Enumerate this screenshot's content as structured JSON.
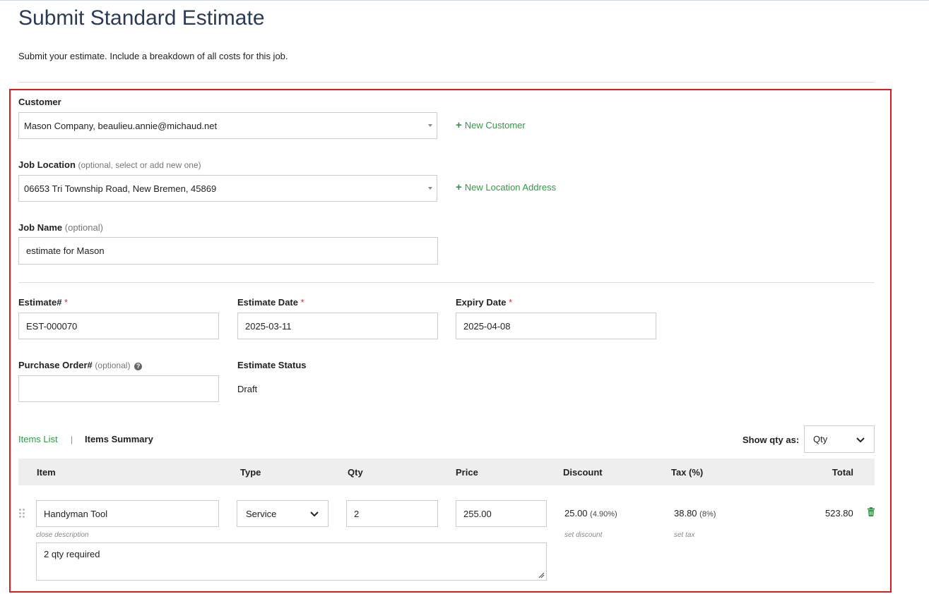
{
  "page": {
    "title": "Submit Standard Estimate",
    "subtitle": "Submit your estimate. Include a breakdown of all costs for this job."
  },
  "customer": {
    "label": "Customer",
    "value": "Mason Company, beaulieu.annie@michaud.net",
    "new_link": "New Customer"
  },
  "job_location": {
    "label": "Job Location",
    "hint": "(optional, select or add new one)",
    "value": "06653 Tri Township Road, New Bremen, 45869",
    "new_link": "New Location Address"
  },
  "job_name": {
    "label": "Job Name",
    "hint": "(optional)",
    "value": "estimate for Mason"
  },
  "estimate_no": {
    "label": "Estimate#",
    "required": "*",
    "value": "EST-000070"
  },
  "estimate_date": {
    "label": "Estimate Date",
    "required": "*",
    "value": "2025-03-11"
  },
  "expiry_date": {
    "label": "Expiry Date",
    "required": "*",
    "value": "2025-04-08"
  },
  "purchase_order": {
    "label": "Purchase Order#",
    "hint": "(optional)",
    "value": ""
  },
  "estimate_status": {
    "label": "Estimate Status",
    "value": "Draft"
  },
  "items_tabs": {
    "list": "Items List",
    "separator": "|",
    "summary": "Items Summary",
    "show_qty_label": "Show qty as:",
    "show_qty_value": "Qty"
  },
  "table": {
    "headers": {
      "item": "Item",
      "type": "Type",
      "qty": "Qty",
      "price": "Price",
      "discount": "Discount",
      "tax": "Tax (%)",
      "total": "Total"
    },
    "rows": [
      {
        "item": "Handyman Tool",
        "type": "Service",
        "qty": "2",
        "price": "255.00",
        "discount": "25.00",
        "discount_pct": "(4.90%)",
        "tax": "38.80",
        "tax_pct": "(8%)",
        "total": "523.80",
        "close_description": "close description",
        "set_discount": "set discount",
        "set_tax": "set tax",
        "description": "2 qty required"
      }
    ]
  },
  "colors": {
    "title": "#2b3a55",
    "accent_green": "#2e9a45",
    "required_red": "#d9262c",
    "highlight_box": "#e0191c"
  },
  "icons": [
    "plus-icon",
    "question-circle-icon",
    "caret-down-icon",
    "chevron-down-icon",
    "drag-handle-icon",
    "trash-icon",
    "resize-grip-icon"
  ]
}
